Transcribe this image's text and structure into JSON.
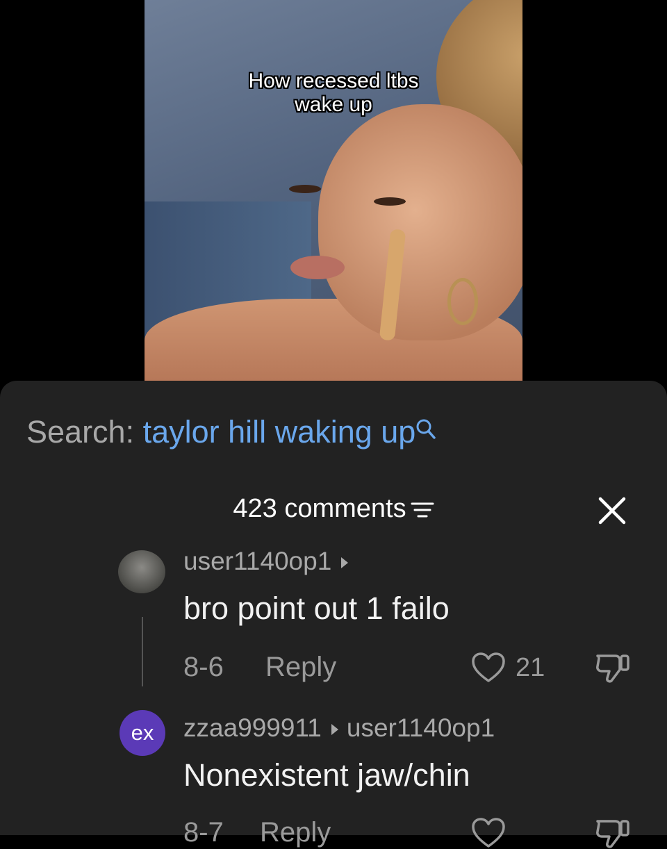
{
  "video": {
    "caption_line1": "How recessed ltbs",
    "caption_line2": "wake up"
  },
  "search": {
    "label": "Search:",
    "query": "taylor hill waking up"
  },
  "comments_header": {
    "count_label": "423 comments"
  },
  "comments": [
    {
      "username": "user1140op1",
      "text": "bro point out 1 failo",
      "date": "8-6",
      "reply_label": "Reply",
      "likes": "21"
    },
    {
      "username": "zzaa999911",
      "reply_to": "user1140op1",
      "avatar_text": "ex",
      "text": "Nonexistent jaw/chin",
      "date": "8-7",
      "reply_label": "Reply"
    }
  ],
  "colors": {
    "sheet_bg": "#222222",
    "search_query": "#6aa7ec",
    "avatar_purple": "#5b3ab7"
  }
}
